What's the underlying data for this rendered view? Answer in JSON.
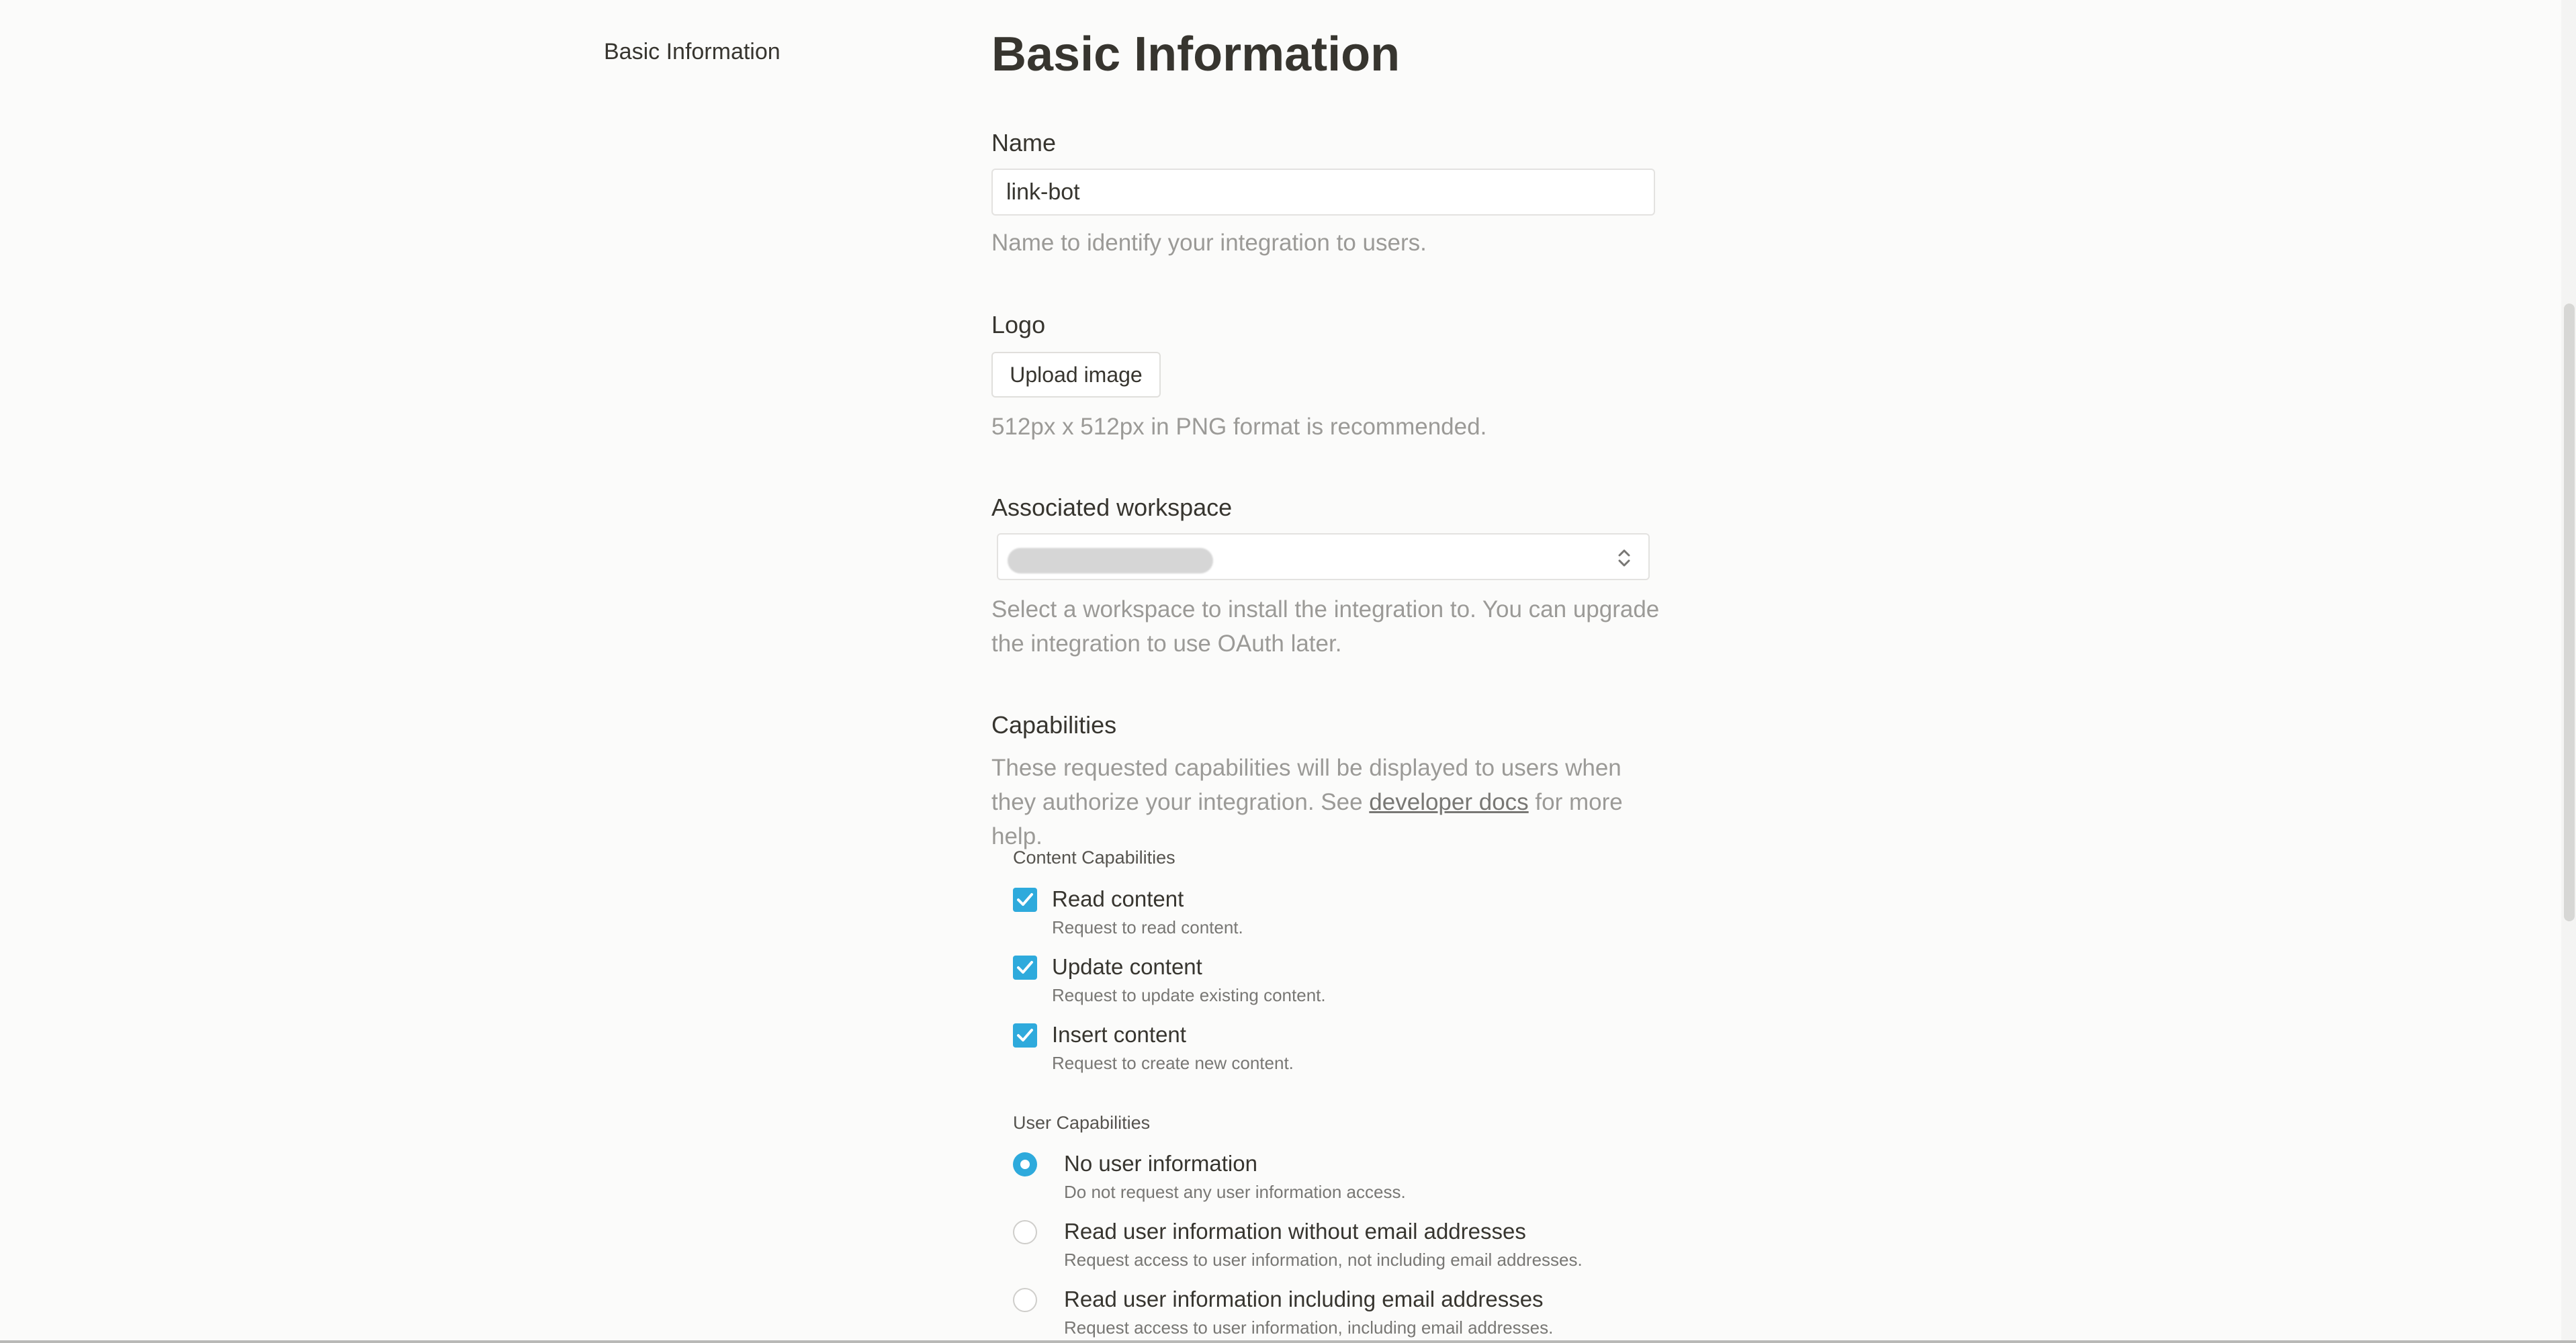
{
  "sidebar": {
    "nav_item": "Basic Information"
  },
  "page": {
    "title": "Basic Information"
  },
  "name_field": {
    "label": "Name",
    "value": "link-bot",
    "help": "Name to identify your integration to users."
  },
  "logo": {
    "label": "Logo",
    "button_label": "Upload image",
    "help": "512px x 512px in PNG format is recommended."
  },
  "workspace": {
    "label": "Associated workspace",
    "help": "Select a workspace to install the integration to. You can upgrade the integration to use OAuth later."
  },
  "capabilities": {
    "title": "Capabilities",
    "help_before": "These requested capabilities will be displayed to users when they authorize your integration. See ",
    "help_link": "developer docs",
    "help_after": " for more help.",
    "content_group_label": "Content Capabilities",
    "content": [
      {
        "label": "Read content",
        "description": "Request to read content.",
        "checked": true
      },
      {
        "label": "Update content",
        "description": "Request to update existing content.",
        "checked": true
      },
      {
        "label": "Insert content",
        "description": "Request to create new content.",
        "checked": true
      }
    ],
    "user_group_label": "User Capabilities",
    "user": [
      {
        "label": "No user information",
        "description": "Do not request any user information access.",
        "selected": true
      },
      {
        "label": "Read user information without email addresses",
        "description": "Request access to user information, not including email addresses.",
        "selected": false
      },
      {
        "label": "Read user information including email addresses",
        "description": "Request access to user information, including email addresses.",
        "selected": false
      }
    ]
  },
  "colors": {
    "accent": "#2eaadc",
    "text": "#37352f",
    "muted": "#9b9a97",
    "background": "#fbfbfa"
  }
}
